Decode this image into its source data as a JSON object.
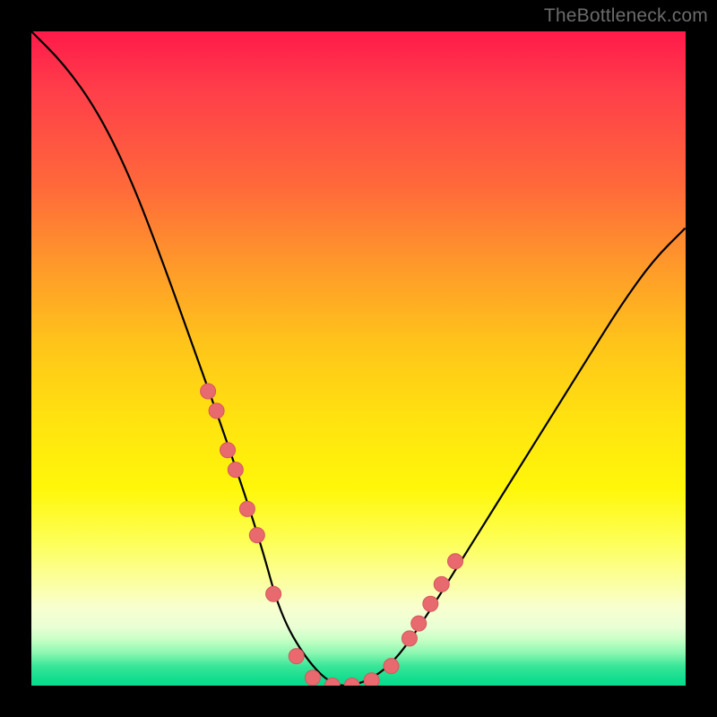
{
  "watermark": "TheBottleneck.com",
  "colors": {
    "curve_stroke": "#000000",
    "marker_fill": "#e86a6f",
    "marker_stroke": "#d6565c",
    "frame_bg": "#000000"
  },
  "chart_data": {
    "type": "line",
    "title": "",
    "xlabel": "",
    "ylabel": "",
    "xlim": [
      0,
      100
    ],
    "ylim": [
      0,
      100
    ],
    "grid": false,
    "legend_position": "none",
    "annotations": [],
    "series": [
      {
        "name": "bottleneck-curve",
        "x": [
          0,
          5,
          10,
          15,
          20,
          25,
          30,
          35,
          38,
          42,
          46,
          50,
          55,
          60,
          65,
          70,
          75,
          80,
          85,
          90,
          95,
          100
        ],
        "values": [
          100,
          95,
          88,
          78,
          65,
          51,
          37,
          22,
          11,
          4,
          0,
          0,
          3,
          10,
          18,
          26,
          34,
          42,
          50,
          58,
          65,
          70
        ]
      }
    ],
    "markers": {
      "name": "curve-dots",
      "x": [
        27.0,
        28.3,
        30.0,
        31.2,
        33.0,
        34.5,
        37.0,
        40.5,
        43.0,
        46.0,
        49.0,
        52.0,
        55.0,
        57.8,
        59.2,
        61.0,
        62.7,
        64.8
      ],
      "values": [
        45.0,
        42.0,
        36.0,
        33.0,
        27.0,
        23.0,
        14.0,
        4.5,
        1.2,
        0.0,
        0.0,
        0.8,
        3.0,
        7.2,
        9.5,
        12.5,
        15.5,
        19.0
      ]
    }
  }
}
